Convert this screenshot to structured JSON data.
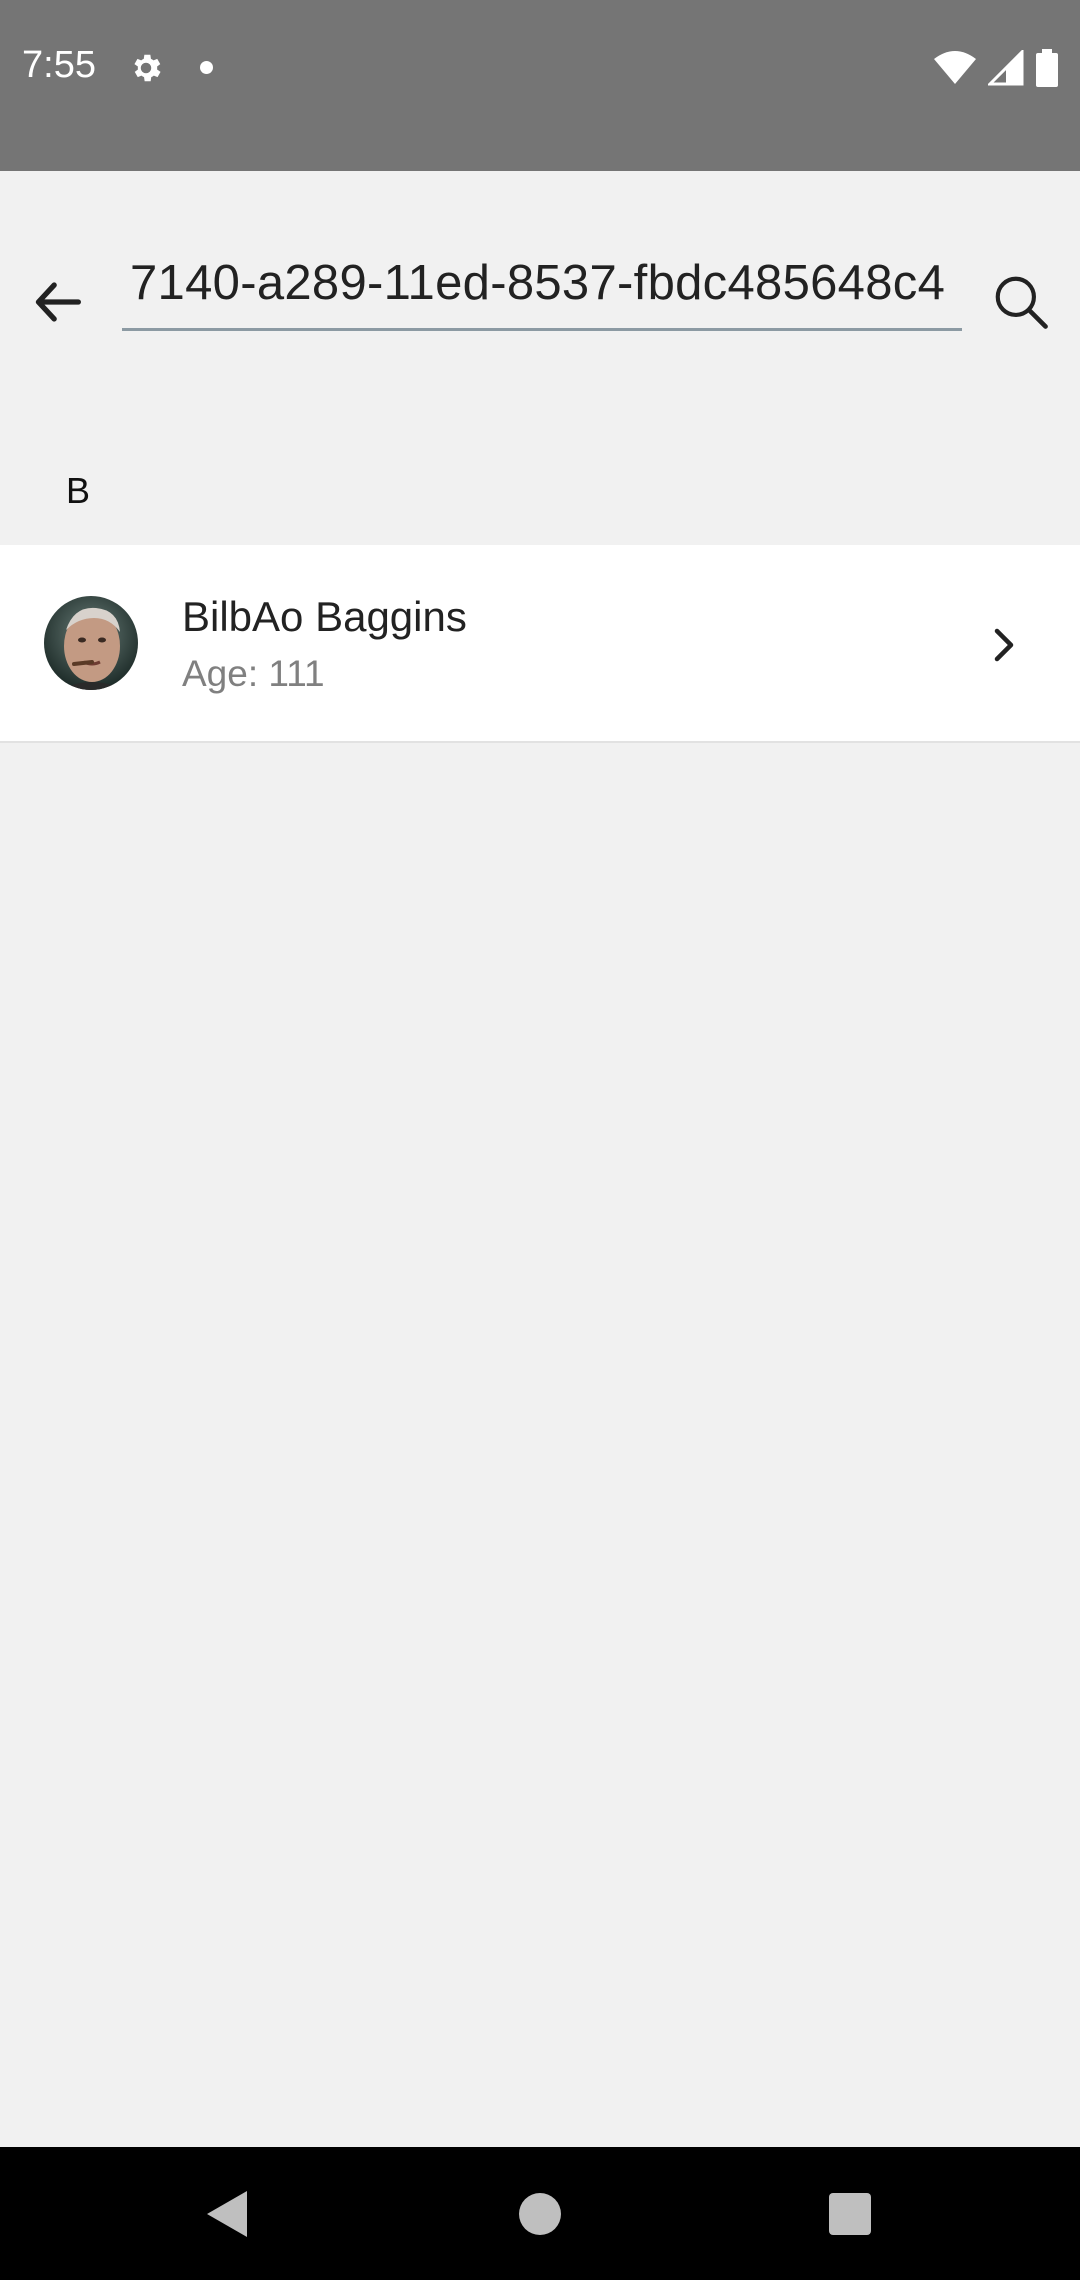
{
  "status_bar": {
    "time": "7:55",
    "icons": [
      "gear-icon",
      "notification-dot-icon",
      "wifi-icon",
      "signal-icon",
      "battery-icon"
    ]
  },
  "search": {
    "query": "7140-a289-11ed-8537-fbdc485648c4",
    "back_icon": "arrow-back-icon",
    "search_icon": "search-icon"
  },
  "list": {
    "section_header": "B",
    "items": [
      {
        "name": "BilbAo Baggins",
        "age_text": "Age: 111",
        "avatar": "avatar-photo",
        "trailing_icon": "chevron-right-icon"
      }
    ]
  },
  "nav_bar": {
    "buttons": [
      "nav-back-icon",
      "nav-home-icon",
      "nav-recents-icon"
    ]
  },
  "colors": {
    "status_bar": "#757575",
    "background": "#f1f1f1",
    "underline": "#8c9aa3",
    "secondary_text": "#808080",
    "nav_bar": "#000000"
  }
}
